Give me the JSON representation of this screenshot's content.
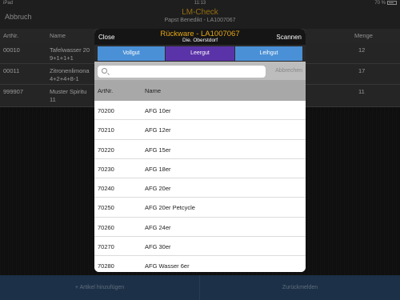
{
  "status_bar": {
    "device": "iPad",
    "time": "11:13",
    "battery": "70 %"
  },
  "nav": {
    "left": "Abbruch",
    "title": "LM-Check",
    "subtitle": "Papst Benedikt - LA1007067"
  },
  "background_table": {
    "headers": {
      "art": "ArtNr.",
      "name": "Name",
      "qty": "Menge"
    },
    "rows": [
      {
        "art": "00010",
        "name1": "Tafelwasser 20",
        "name2": "9+1+1+1",
        "qty": "12"
      },
      {
        "art": "00011",
        "name1": "Zitronenlimona",
        "name2": "4+2+4+8-1",
        "qty": "17"
      },
      {
        "art": "999907",
        "name1": "Muster Spiritu",
        "name2": "11",
        "qty": "11"
      }
    ]
  },
  "bottom_bar": {
    "add": "+ Artikel hinzufügen",
    "report": "Zurückmelden"
  },
  "modal": {
    "close": "Close",
    "title": "Rückware - LA1007067",
    "subtitle": "Die. Oberstdorf",
    "scan": "Scannen",
    "tabs": [
      "Vollgut",
      "Leergut",
      "Leihgut"
    ],
    "active_tab": "Leergut",
    "search": {
      "placeholder": "",
      "cancel": "Abbrechen"
    },
    "columns": {
      "art": "ArtNr.",
      "name": "Name"
    },
    "items": [
      {
        "art": "70200",
        "name": "AFG 10er"
      },
      {
        "art": "70210",
        "name": "AFG 12er"
      },
      {
        "art": "70220",
        "name": "AFG 15er"
      },
      {
        "art": "70230",
        "name": "AFG 18er"
      },
      {
        "art": "70240",
        "name": "AFG 20er"
      },
      {
        "art": "70250",
        "name": "AFG 20er Petcycle"
      },
      {
        "art": "70260",
        "name": "AFG 24er"
      },
      {
        "art": "70270",
        "name": "AFG 30er"
      },
      {
        "art": "70280",
        "name": "AFG Wasser 6er"
      }
    ]
  },
  "colors": {
    "accent": "#e6a817",
    "tab_blue": "#4a90d6",
    "tab_active": "#5b33a8",
    "bottom_bar": "#2b4a6e"
  }
}
